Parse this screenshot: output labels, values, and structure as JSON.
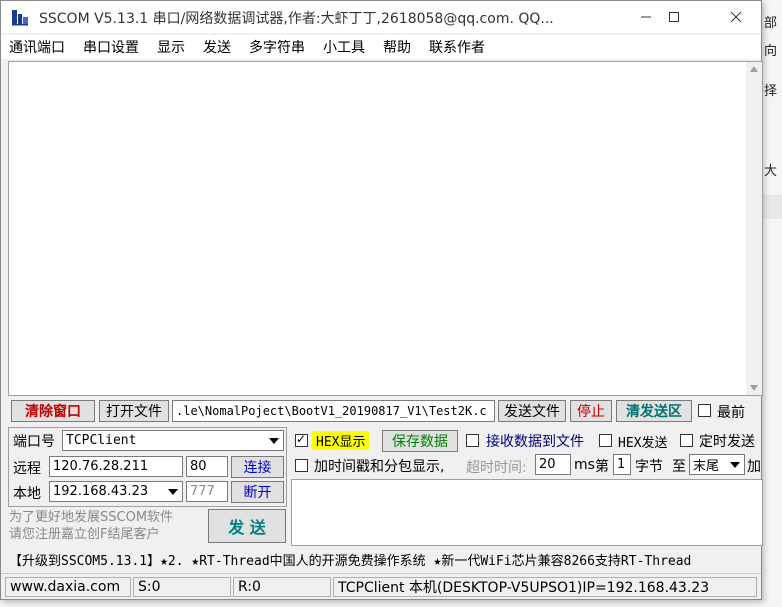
{
  "window": {
    "title": "SSCOM V5.13.1 串口/网络数据调试器,作者:大虾丁丁,2618058@qq.com. QQ..."
  },
  "menu": [
    "通讯端口",
    "串口设置",
    "显示",
    "发送",
    "多字符串",
    "小工具",
    "帮助",
    "联系作者"
  ],
  "toolbar": {
    "clear_window": "清除窗口",
    "open_file": "打开文件",
    "file_path": ".le\\NomalPoject\\BootV1_20190817_V1\\Test2K.c",
    "send_file": "发送文件",
    "stop": "停止",
    "clear_send": "清发送区",
    "topmost_label": "最前",
    "topmost_checked": false
  },
  "connection": {
    "port_label": "端口号",
    "port_value": "TCPClient",
    "remote_label": "远程",
    "remote_ip": "120.76.28.211",
    "remote_port": "80",
    "connect_button": "连接",
    "local_label": "本地",
    "local_ip": "192.168.43.23",
    "local_port": "777",
    "disconnect_button": "断开"
  },
  "options": {
    "hex_display_label": "HEX显示",
    "hex_display_checked": true,
    "save_data_button": "保存数据",
    "recv_to_file_label": "接收数据到文件",
    "recv_to_file_checked": false,
    "hex_send_label": "HEX发送",
    "hex_send_checked": false,
    "timed_send_label": "定时发送",
    "timed_send_checked": false,
    "timestamp_label": "加时间戳和分包显示,",
    "timestamp_checked": false,
    "timeout_label": "超时时间:",
    "timeout_value": "20",
    "timeout_unit": "ms",
    "byte_prefix": "第",
    "byte_index": "1",
    "byte_label": "字节",
    "to_label": "至",
    "end_select": "末尾",
    "add_label": "加"
  },
  "promo_left": "为了更好地发展SSCOM软件\n请您注册嘉立创F结尾客户",
  "send_button": "发 送",
  "promo_banner": "【升级到SSCOM5.13.1】★2. ★RT-Thread中国人的开源免费操作系统 ★新一代WiFi芯片兼容8266支持RT-Thread",
  "status": {
    "website": "www.daxia.com",
    "sent": "S:0",
    "received": "R:0",
    "info": "TCPClient 本机(DESKTOP-V5UPSO1)IP=192.168.43.23"
  },
  "background": {
    "right_texts": [
      "部",
      "向",
      "择",
      "大"
    ]
  },
  "colors": {
    "hex_highlight": "#ffff00",
    "clear_window_text": "#c00000",
    "save_data_text": "#008000",
    "connect_text": "#0000cc"
  }
}
